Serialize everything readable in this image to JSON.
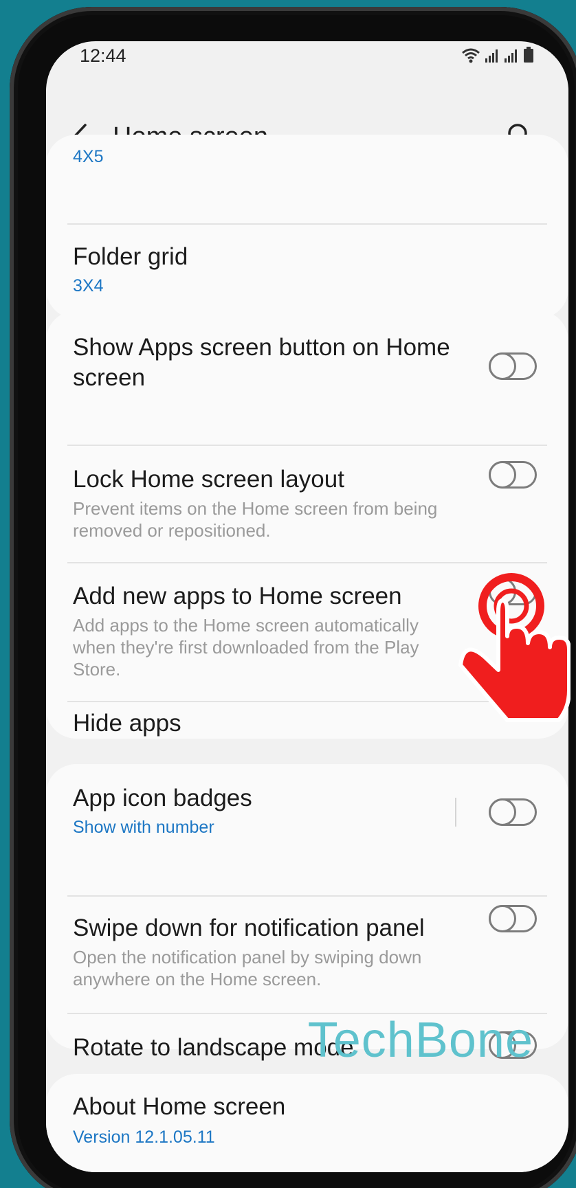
{
  "status": {
    "time": "12:44"
  },
  "header": {
    "title": "Home screen"
  },
  "grid_card": {
    "home_grid_value": "4X5",
    "folder_grid_title": "Folder grid",
    "folder_grid_value": "3X4"
  },
  "layout_card": {
    "show_apps_button_title": "Show Apps screen button on Home screen",
    "lock_layout_title": "Lock Home screen layout",
    "lock_layout_sub": "Prevent items on the Home screen from being removed or repositioned.",
    "add_new_apps_title": "Add new apps to Home screen",
    "add_new_apps_sub": "Add apps to the Home screen automatically when they're first downloaded from the Play Store.",
    "hide_apps_title": "Hide apps"
  },
  "misc_card": {
    "badges_title": "App icon badges",
    "badges_value": "Show with number",
    "swipe_title": "Swipe down for notification panel",
    "swipe_sub": "Open the notification panel by swiping down anywhere on the Home screen.",
    "rotate_title": "Rotate to landscape mode"
  },
  "about_card": {
    "about_title": "About Home screen",
    "version": "Version 12.1.05.11"
  },
  "watermark": "TechBone",
  "toggles": {
    "show_apps_button": false,
    "lock_layout": false,
    "add_new_apps": false,
    "badges": false,
    "swipe_down": false,
    "rotate": false
  },
  "colors": {
    "background": "#137f8f",
    "accent": "#1d77c4",
    "tap_indicator": "#f01e1e",
    "watermark": "#5fc2cd"
  }
}
